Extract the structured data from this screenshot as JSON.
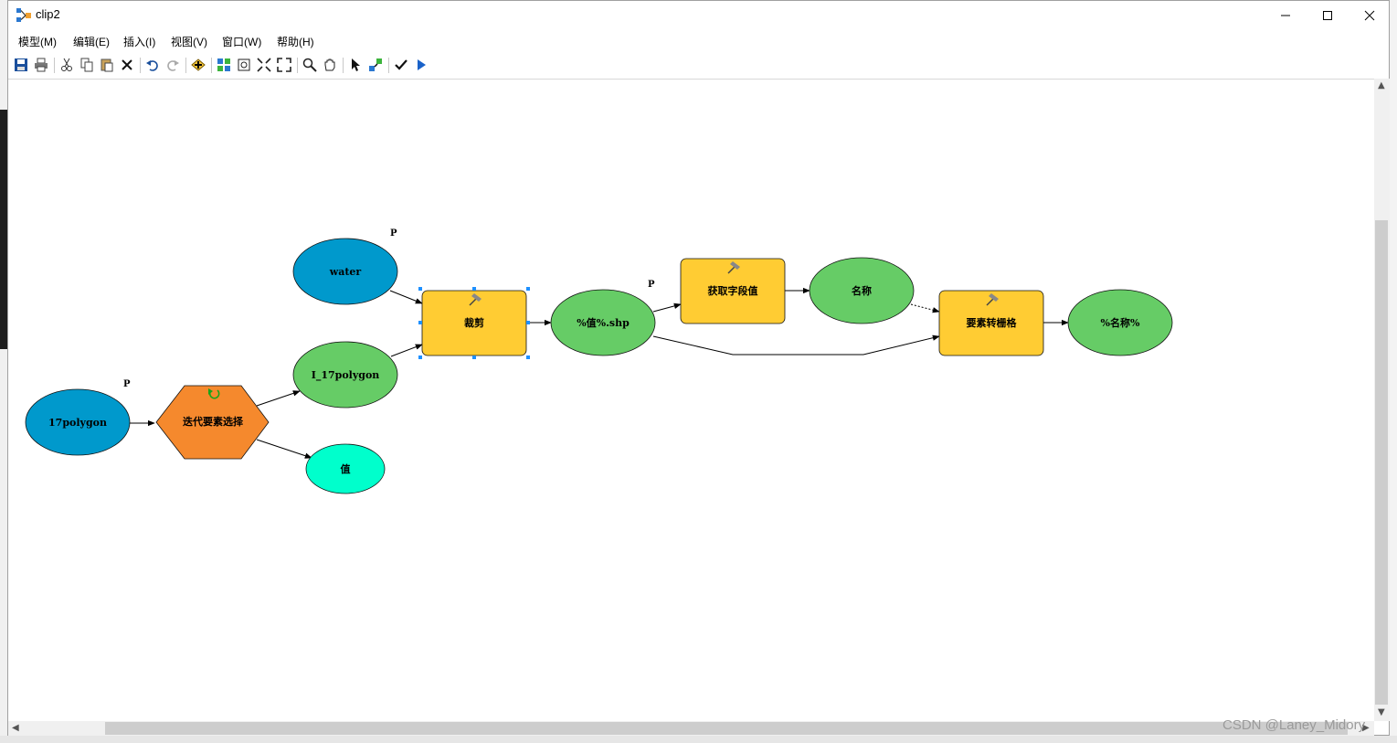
{
  "window": {
    "title": "clip2"
  },
  "menu": [
    "模型(M)",
    "编辑(E)",
    "插入(I)",
    "视图(V)",
    "窗口(W)",
    "帮助(H)"
  ],
  "toolbar": [
    "save-icon",
    "print-icon",
    "cut-icon",
    "copy-icon",
    "paste-icon",
    "delete-icon",
    "undo-icon",
    "redo-icon",
    "add-data-icon",
    "auto-layout-icon",
    "full-extent-icon",
    "zoom-in-fixed-icon",
    "zoom-out-fixed-icon",
    "zoom-icon",
    "pan-icon",
    "select-icon",
    "connect-icon",
    "validate-icon",
    "run-icon"
  ],
  "nodes": {
    "water": {
      "label": "water",
      "color": "#0099cc"
    },
    "polygon17": {
      "label": "17polygon",
      "color": "#0099cc"
    },
    "iterate": {
      "label": "迭代要素选择",
      "color": "#f5892d"
    },
    "i17polygon": {
      "label": "I_17polygon",
      "color": "#66cc66"
    },
    "value": {
      "label": "值",
      "color": "#00ffcc"
    },
    "clip": {
      "label": "裁剪",
      "color": "#ffcc33"
    },
    "valshp": {
      "label": "%值%.shp",
      "color": "#66cc66"
    },
    "getfield": {
      "label": "获取字段值",
      "color": "#ffcc33"
    },
    "name": {
      "label": "名称",
      "color": "#66cc66"
    },
    "toraster": {
      "label": "要素转栅格",
      "color": "#ffcc33"
    },
    "nameout": {
      "label": "%名称%",
      "color": "#66cc66"
    }
  },
  "param_marker": "P",
  "watermark": "CSDN @Laney_Midory"
}
